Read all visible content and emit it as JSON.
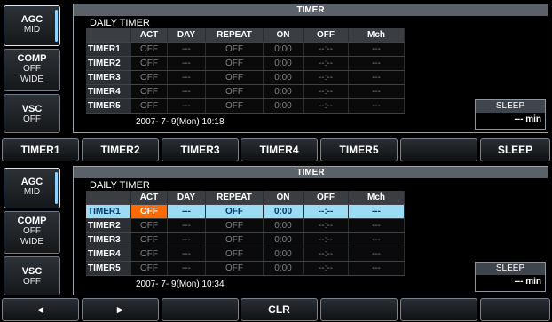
{
  "side": {
    "agc": {
      "title": "AGC",
      "value": "MID"
    },
    "comp": {
      "title": "COMP",
      "line2": "OFF",
      "line3": "WIDE"
    },
    "vsc": {
      "title": "VSC",
      "value": "OFF"
    }
  },
  "panel_title": "TIMER",
  "subtitle": "DAILY TIMER",
  "columns": [
    "ACT",
    "DAY",
    "REPEAT",
    "ON",
    "OFF",
    "Mch"
  ],
  "rows": [
    {
      "name": "TIMER1",
      "act": "OFF",
      "day": "---",
      "repeat": "OFF",
      "on": "0:00",
      "off": "--:--",
      "mch": "---"
    },
    {
      "name": "TIMER2",
      "act": "OFF",
      "day": "---",
      "repeat": "OFF",
      "on": "0:00",
      "off": "--:--",
      "mch": "---"
    },
    {
      "name": "TIMER3",
      "act": "OFF",
      "day": "---",
      "repeat": "OFF",
      "on": "0:00",
      "off": "--:--",
      "mch": "---"
    },
    {
      "name": "TIMER4",
      "act": "OFF",
      "day": "---",
      "repeat": "OFF",
      "on": "0:00",
      "off": "--:--",
      "mch": "---"
    },
    {
      "name": "TIMER5",
      "act": "OFF",
      "day": "---",
      "repeat": "OFF",
      "on": "0:00",
      "off": "--:--",
      "mch": "---"
    }
  ],
  "screen1": {
    "datetime": "2007- 7- 9(Mon) 10:18",
    "fkeys": [
      "TIMER1",
      "TIMER2",
      "TIMER3",
      "TIMER4",
      "TIMER5",
      "",
      "SLEEP"
    ]
  },
  "screen2": {
    "datetime": "2007- 7- 9(Mon) 10:34",
    "selected_row": 0,
    "fkeys": [
      "◄",
      "►",
      "",
      "CLR",
      "",
      "",
      ""
    ]
  },
  "sleep": {
    "label": "SLEEP",
    "value": "--- min"
  },
  "colors": {
    "selected_row": "#9adcf3",
    "active_cell": "#ff6a00",
    "background": "#000000"
  }
}
